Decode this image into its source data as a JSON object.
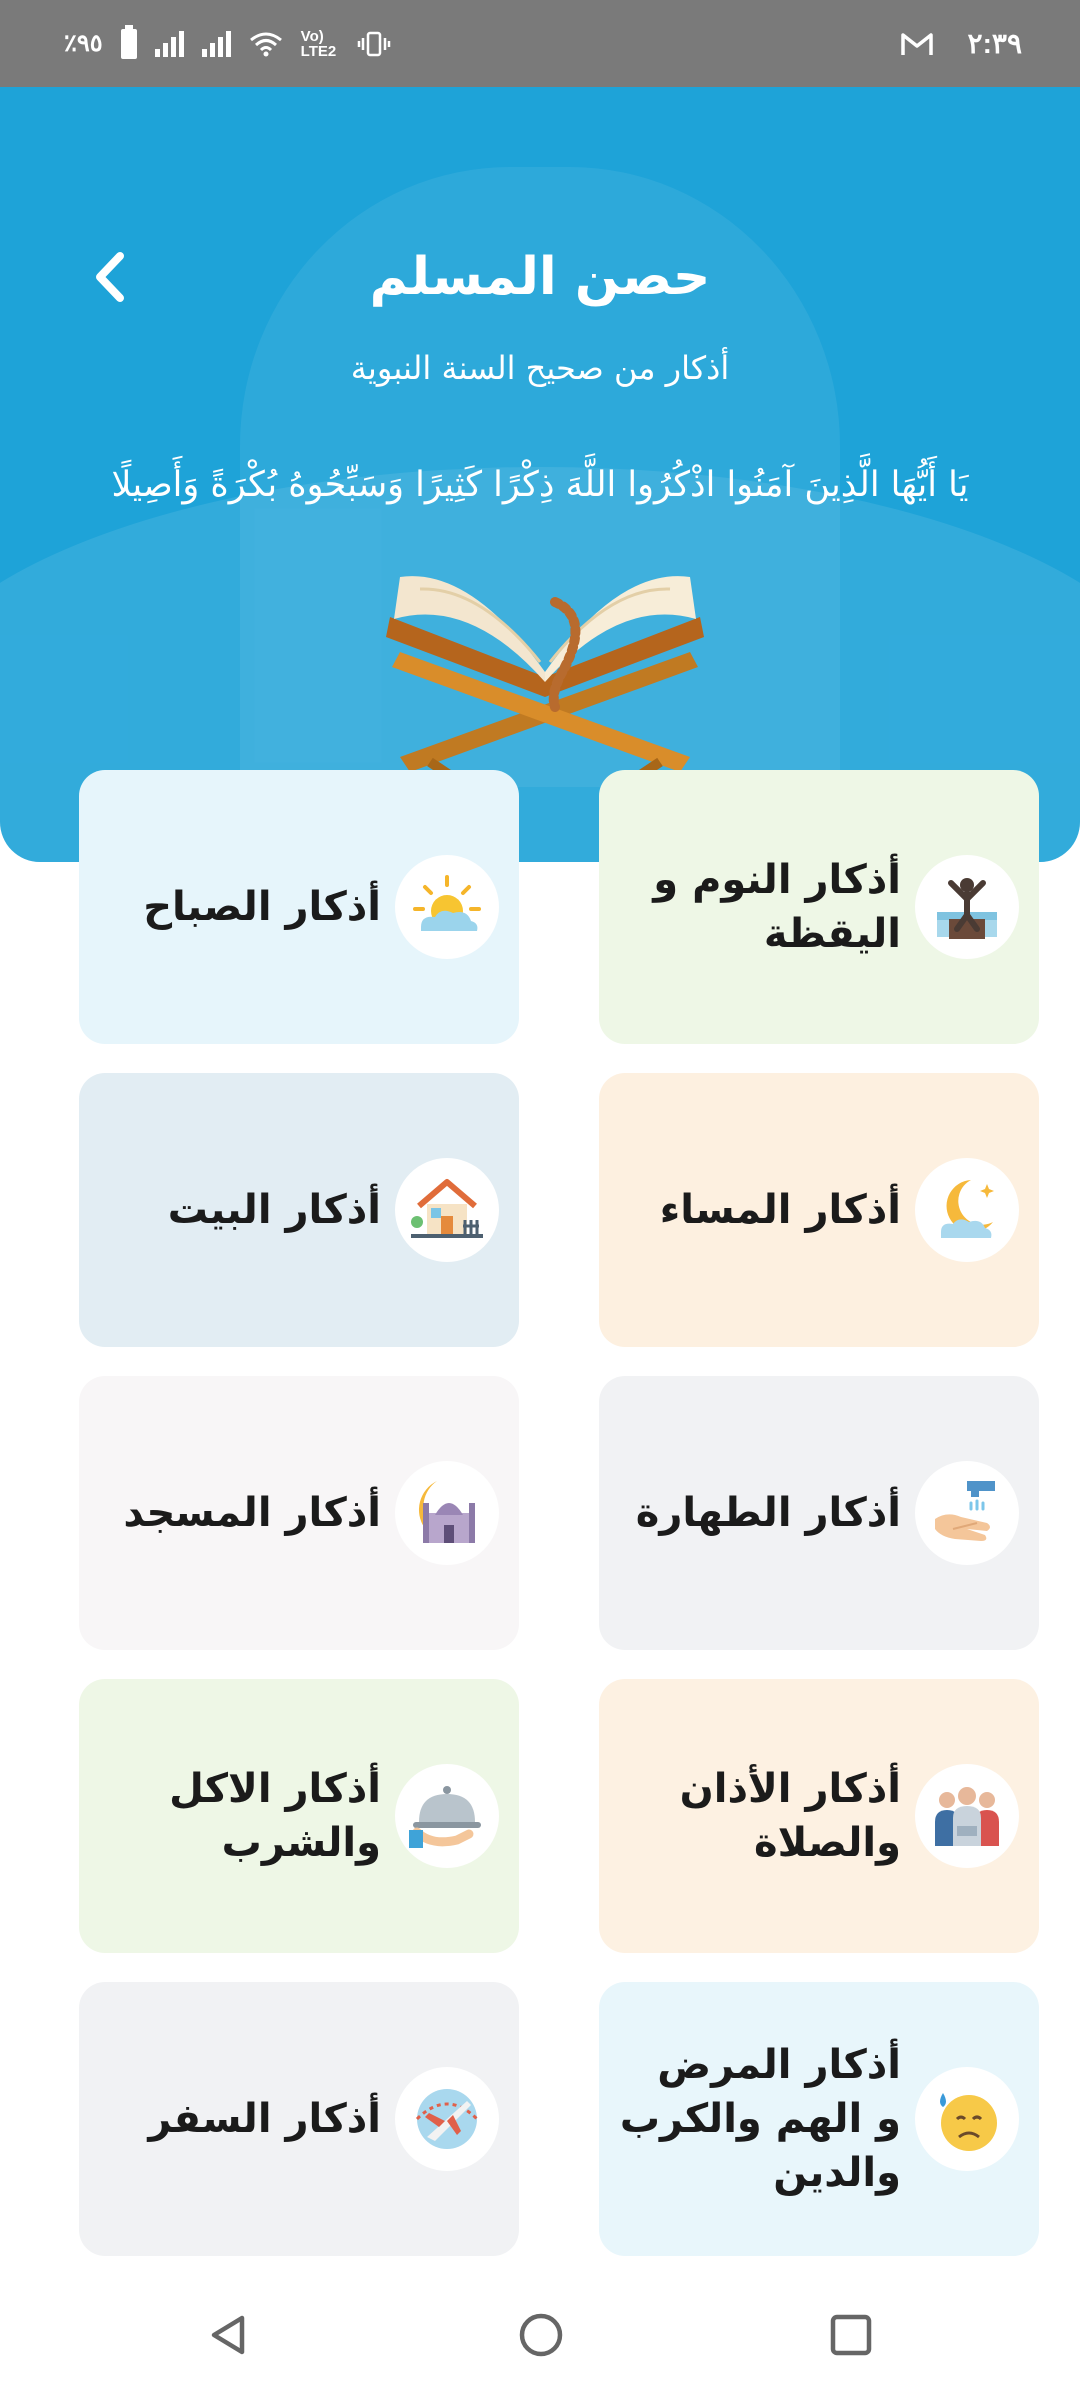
{
  "status_bar": {
    "time": "٢:٣٩",
    "battery_text": "٪٩٥",
    "network_text": "Vo) LTE2",
    "icons": [
      "battery-icon",
      "signal-icon",
      "wifi-icon",
      "vibrate-icon",
      "gmail-icon"
    ]
  },
  "header": {
    "title": "حصن المسلم",
    "subtitle": "أذكار من صحيح السنة النبوية",
    "verse": "يَا أَيُّهَا الَّذِينَ آمَنُوا اذْكُرُوا اللَّهَ ذِكْرًا كَثِيرًا وَسَبِّحُوهُ بُكْرَةً وَأَصِيلًا",
    "back_icon": "chevron-left-icon",
    "background_color": "#1ea3d8"
  },
  "categories": [
    {
      "label": "أذكار النوم و اليقظة",
      "icon": "waking-person-icon",
      "bg": "#eef7e6"
    },
    {
      "label": "أذكار الصباح",
      "icon": "sunrise-icon",
      "bg": "#e6f5fb"
    },
    {
      "label": "أذكار المساء",
      "icon": "crescent-moon-icon",
      "bg": "#fdf0e0"
    },
    {
      "label": "أذكار البيت",
      "icon": "house-icon",
      "bg": "#e2edf3"
    },
    {
      "label": "أذكار الطهارة",
      "icon": "hand-washing-icon",
      "bg": "#f1f2f4"
    },
    {
      "label": "أذكار المسجد",
      "icon": "mosque-icon",
      "bg": "#f8f6f7"
    },
    {
      "label": "أذكار الأذان والصلاة",
      "icon": "praying-people-icon",
      "bg": "#fdf1e2"
    },
    {
      "label": "أذكار الاكل والشرب",
      "icon": "food-platter-icon",
      "bg": "#eef7e6"
    },
    {
      "label": "أذكار المرض و الهم والكرب والدين",
      "icon": "sad-face-icon",
      "bg": "#e8f6fb"
    },
    {
      "label": "أذكار السفر",
      "icon": "airplane-icon",
      "bg": "#f1f2f4"
    }
  ],
  "nav_bar": {
    "icons": [
      "back-triangle-icon",
      "home-circle-icon",
      "recents-square-icon"
    ]
  }
}
